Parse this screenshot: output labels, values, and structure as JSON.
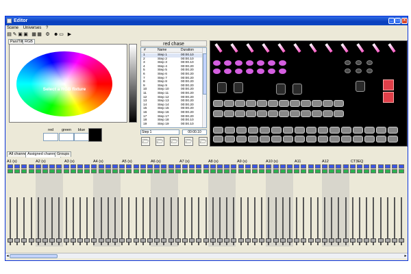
{
  "window": {
    "title": "Editor"
  },
  "menu": [
    "Scene",
    "Universes",
    "?"
  ],
  "top_tabs": [
    "Pan/Tilt",
    "RGB"
  ],
  "color_picker": {
    "label": "Select a RGB fixture",
    "red_label": "red",
    "green_label": "green",
    "blue_label": "blue"
  },
  "chase": {
    "title": "red chase",
    "columns": [
      "#",
      "Name",
      "Duration"
    ],
    "steps": [
      {
        "n": "1",
        "name": "Step 1",
        "dur": "00:00.10"
      },
      {
        "n": "2",
        "name": "Step 2",
        "dur": "00:00.10"
      },
      {
        "n": "3",
        "name": "Step 3",
        "dur": "00:00.10"
      },
      {
        "n": "4",
        "name": "Step 4",
        "dur": "00:00.20"
      },
      {
        "n": "5",
        "name": "Step 5",
        "dur": "00:00.20"
      },
      {
        "n": "6",
        "name": "Step 6",
        "dur": "00:00.20"
      },
      {
        "n": "7",
        "name": "Step 7",
        "dur": "00:00.20"
      },
      {
        "n": "8",
        "name": "Step 8",
        "dur": "00:00.20"
      },
      {
        "n": "9",
        "name": "Step 9",
        "dur": "00:00.20"
      },
      {
        "n": "10",
        "name": "Step 10",
        "dur": "00:00.20"
      },
      {
        "n": "11",
        "name": "Step 11",
        "dur": "00:00.20"
      },
      {
        "n": "12",
        "name": "Step 12",
        "dur": "00:00.20"
      },
      {
        "n": "13",
        "name": "Step 13",
        "dur": "00:00.20"
      },
      {
        "n": "14",
        "name": "Step 14",
        "dur": "00:00.20"
      },
      {
        "n": "15",
        "name": "Step 15",
        "dur": "00:00.20"
      },
      {
        "n": "16",
        "name": "Step 16",
        "dur": "00:00.20"
      },
      {
        "n": "17",
        "name": "Step 17",
        "dur": "00:00.20"
      },
      {
        "n": "18",
        "name": "Step 18",
        "dur": "00:00.10"
      },
      {
        "n": "19",
        "name": "Step 19",
        "dur": "00:00.10"
      }
    ],
    "step_name_value": "Step 1",
    "step_time_value": "00:00.10"
  },
  "bottom_tabs": [
    "All channel",
    "Assigned channels",
    "Groups"
  ],
  "channel_groups": [
    "A1 (s)",
    "A2 (s)",
    "A3 (s)",
    "A4 (s)",
    "A5 (s)",
    "A6 (s)",
    "A7 (s)",
    "A8 (s)",
    "A9 (s)",
    "A10 (s)",
    "A11",
    "A12",
    "CT3EQ"
  ],
  "colors": {
    "title": "#0a3fbd",
    "accent": "#3a55e8",
    "green": "#2bb34f",
    "pink": "#d45ee0"
  }
}
